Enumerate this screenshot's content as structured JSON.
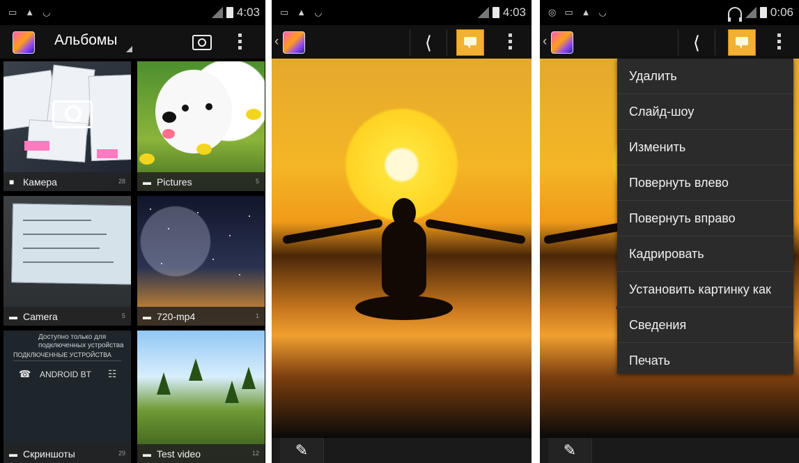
{
  "screen1": {
    "status": {
      "time": "4:03"
    },
    "actionbar": {
      "title": "Альбомы"
    },
    "albums": [
      {
        "name": "Камера",
        "count": "28",
        "icon": "camera-icon"
      },
      {
        "name": "Pictures",
        "count": "5",
        "icon": "folder-icon"
      },
      {
        "name": "Camera",
        "count": "5",
        "icon": "folder-icon"
      },
      {
        "name": "720-mp4",
        "count": "1",
        "icon": "folder-icon"
      },
      {
        "name": "Скриншоты",
        "count": "29",
        "icon": "folder-icon"
      },
      {
        "name": "Test video",
        "count": "12",
        "icon": "folder-icon"
      }
    ],
    "screenshot_thumb": {
      "note_line1": "Доступно только для",
      "note_line2": "подключенных устройства",
      "section": "ПОДКЛЮЧЕННЫЕ УСТРОЙСТВА",
      "device": "ANDROID BT"
    }
  },
  "screen2": {
    "status": {
      "time": "4:03"
    }
  },
  "screen3": {
    "status": {
      "time": "0:06"
    },
    "menu": [
      "Удалить",
      "Слайд-шоу",
      "Изменить",
      "Повернуть влево",
      "Повернуть вправо",
      "Кадрировать",
      "Установить картинку как",
      "Сведения",
      "Печать"
    ]
  }
}
